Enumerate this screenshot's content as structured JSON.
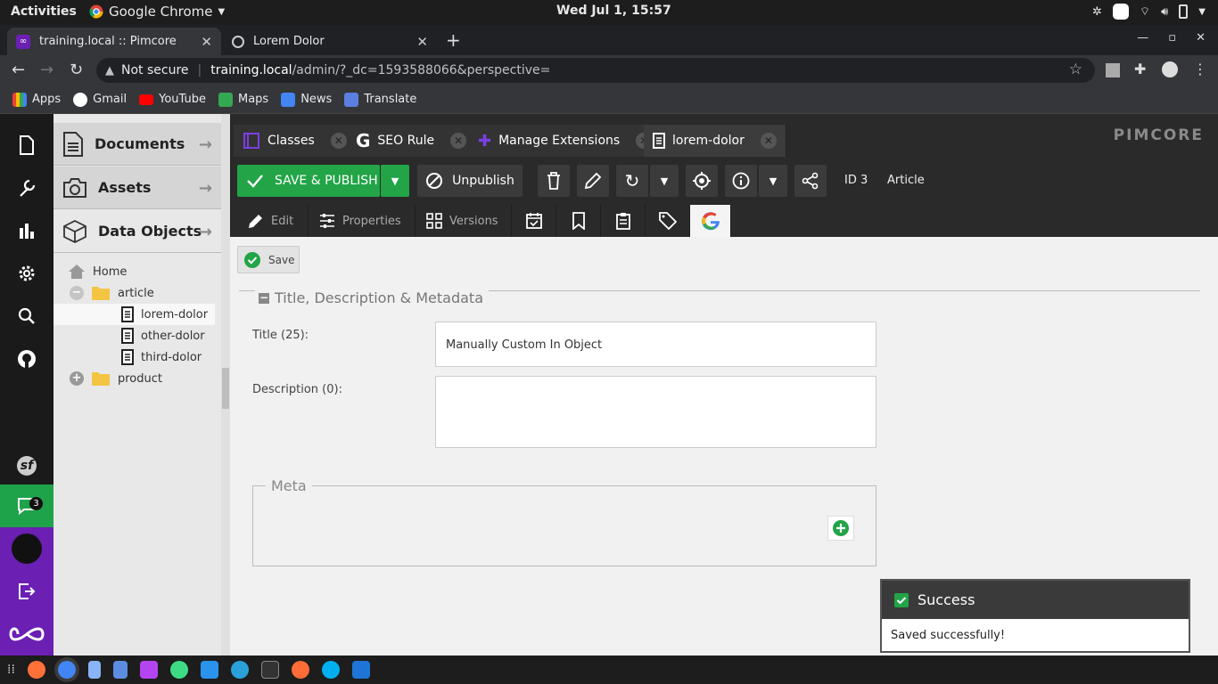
{
  "os": {
    "activities": "Activities",
    "app_name": "Google Chrome",
    "clock": "Wed Jul  1, 15:57"
  },
  "browser": {
    "tabs": [
      {
        "label": "training.local :: Pimcore",
        "active": true
      },
      {
        "label": "Lorem Dolor",
        "active": false
      }
    ],
    "security": "Not secure",
    "url_host": "training.local",
    "url_path": "/admin/?_dc=1593588066&perspective=",
    "bookmarks": [
      "Apps",
      "Gmail",
      "YouTube",
      "Maps",
      "News",
      "Translate"
    ]
  },
  "sidebar": {
    "chat_badge": "3"
  },
  "tree": {
    "sections": [
      "Documents",
      "Assets",
      "Data Objects"
    ],
    "nodes": [
      "Home",
      "article",
      "lorem-dolor",
      "other-dolor",
      "third-dolor",
      "product"
    ]
  },
  "editor_tabs": [
    "Classes",
    "SEO Rule",
    "Manage Extensions",
    "lorem-dolor"
  ],
  "brand": "PIMCORE",
  "toolbar": {
    "save_publish": "SAVE & PUBLISH",
    "unpublish": "Unpublish",
    "id_label": "ID 3",
    "class_label": "Article"
  },
  "subtabs": [
    "Edit",
    "Properties",
    "Versions"
  ],
  "form": {
    "save": "Save",
    "section_title": "Title, Description & Metadata",
    "title_label": "Title (25):",
    "title_value": "Manually Custom In Object",
    "description_label": "Description (0):",
    "description_value": "",
    "meta_legend": "Meta"
  },
  "toast": {
    "title": "Success",
    "message": "Saved successfully!"
  },
  "colors": {
    "accent_green": "#22a447",
    "purple": "#6b1fb3",
    "chat_green": "#1ea34a"
  }
}
